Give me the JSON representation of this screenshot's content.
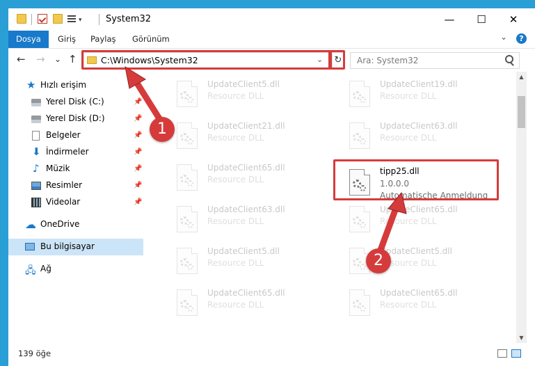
{
  "window": {
    "title": "System32"
  },
  "quick_access_toolbar": {
    "icons": [
      "folder-icon",
      "properties-icon",
      "new-folder-icon",
      "view-icon"
    ],
    "dropdown": "▾"
  },
  "window_controls": {
    "minimize": "—",
    "maximize": "☐",
    "close": "✕"
  },
  "ribbon": {
    "tabs": [
      {
        "label": "Dosya",
        "active": true
      },
      {
        "label": "Giriş",
        "active": false
      },
      {
        "label": "Paylaş",
        "active": false
      },
      {
        "label": "Görünüm",
        "active": false
      }
    ],
    "expand": "⌄",
    "help": "?"
  },
  "navigation": {
    "back": "←",
    "forward": "→",
    "recent": "⌄",
    "up": "↑"
  },
  "address": {
    "path": "C:\\Windows\\System32",
    "dropdown": "⌄",
    "refresh": "↻"
  },
  "search": {
    "placeholder": "Ara: System32"
  },
  "sidebar": {
    "items": [
      {
        "label": "Hızlı erişim",
        "icon": "star-icon"
      },
      {
        "label": "Yerel Disk (C:)",
        "icon": "disk-icon",
        "pinned": true
      },
      {
        "label": "Yerel Disk (D:)",
        "icon": "disk-icon",
        "pinned": true
      },
      {
        "label": "Belgeler",
        "icon": "document-icon",
        "pinned": true
      },
      {
        "label": "İndirmeler",
        "icon": "download-icon",
        "pinned": true
      },
      {
        "label": "Müzik",
        "icon": "music-icon",
        "pinned": true
      },
      {
        "label": "Resimler",
        "icon": "pictures-icon",
        "pinned": true
      },
      {
        "label": "Videolar",
        "icon": "video-icon",
        "pinned": true
      },
      {
        "label": "OneDrive",
        "icon": "cloud-icon"
      },
      {
        "label": "Bu bilgisayar",
        "icon": "computer-icon",
        "selected": true
      },
      {
        "label": "Ağ",
        "icon": "network-icon"
      }
    ],
    "pin_glyph": "📌"
  },
  "files": {
    "left": [
      {
        "name": "UpdateClient5.dll",
        "type": "Resource DLL"
      },
      {
        "name": "UpdateClient21.dll",
        "type": "Resource DLL"
      },
      {
        "name": "UpdateClient65.dll",
        "type": "Resource DLL"
      },
      {
        "name": "UpdateClient63.dll",
        "type": "Resource DLL"
      },
      {
        "name": "UpdateClient5.dll",
        "type": "Resource DLL"
      },
      {
        "name": "UpdateClient65.dll",
        "type": "Resource DLL"
      }
    ],
    "right": [
      {
        "name": "UpdateClient19.dll",
        "type": "Resource DLL"
      },
      {
        "name": "UpdateClient63.dll",
        "type": "Resource DLL"
      },
      {
        "name": "UpdateClient65.dll",
        "type": "Resource DLL"
      },
      {
        "name": "UpdateClient5.dll",
        "type": "Resource DLL"
      },
      {
        "name": "UpdateClient65.dll",
        "type": "Resource DLL"
      }
    ],
    "highlighted": {
      "name": "tipp25.dll",
      "version": "1.0.0.0",
      "description": "Automatische Anmeldung"
    }
  },
  "scrollbar": {
    "up": "▲",
    "down": "▼"
  },
  "status": {
    "item_count": "139 öğe"
  },
  "annotations": {
    "badge1": "1",
    "badge2": "2",
    "color": "#d63b3b"
  },
  "colors": {
    "accent": "#1979ca",
    "selection": "#cce4f7",
    "annotation": "#d63b3b"
  }
}
